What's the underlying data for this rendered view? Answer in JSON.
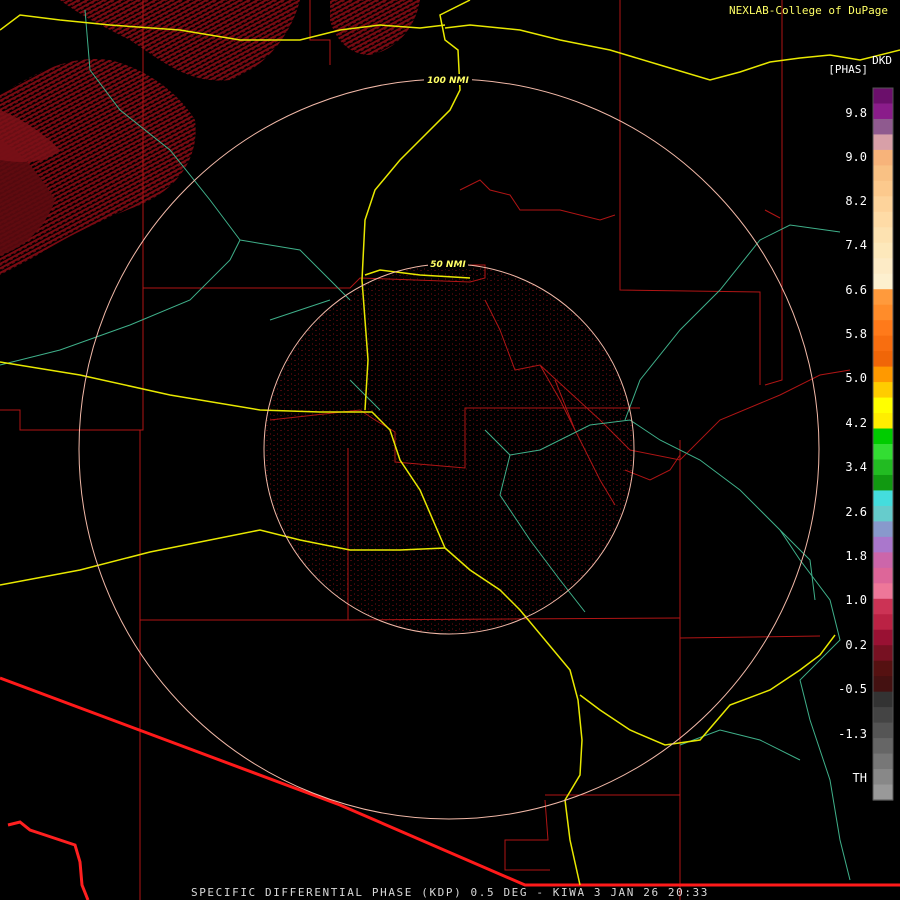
{
  "map": {
    "credit": "NEXLAB-College of DuPage",
    "product_code": "DKD",
    "units": "[PHAS]",
    "footer": "SPECIFIC DIFFERENTIAL PHASE (KDP) 0.5 DEG - KIWA 3 JAN 26 20:33",
    "range_rings": [
      "50 NMI",
      "100 NMI"
    ]
  },
  "legend": {
    "ticks": [
      "9.8",
      "9.0",
      "8.2",
      "7.4",
      "6.6",
      "5.8",
      "5.0",
      "4.2",
      "3.4",
      "2.6",
      "1.8",
      "1.0",
      "0.2",
      "-0.5",
      "-1.3",
      "TH"
    ],
    "colors": [
      "#6b0f6b",
      "#8a1c8a",
      "#8f5a8f",
      "#d8a0a8",
      "#f7b37a",
      "#f9c184",
      "#fcc98d",
      "#fdd39b",
      "#fedba6",
      "#fde2b1",
      "#fde8bb",
      "#fdebc6",
      "#fdf0cf",
      "#ff9a3c",
      "#ff8c2a",
      "#ff7a1a",
      "#f86e10",
      "#f06608",
      "#ff9900",
      "#ffcc00",
      "#ffff00",
      "#ffee00",
      "#00cc00",
      "#33dd33",
      "#22bb22",
      "#119911",
      "#44dddd",
      "#66cccc",
      "#8899cc",
      "#aa77cc",
      "#cc66aa",
      "#dd6699",
      "#ee7799",
      "#cc3355",
      "#bb2244",
      "#991133",
      "#771122",
      "#551111",
      "#441111",
      "#333333",
      "#444444",
      "#555555",
      "#666666",
      "#777777",
      "#888888",
      "#999999"
    ]
  }
}
